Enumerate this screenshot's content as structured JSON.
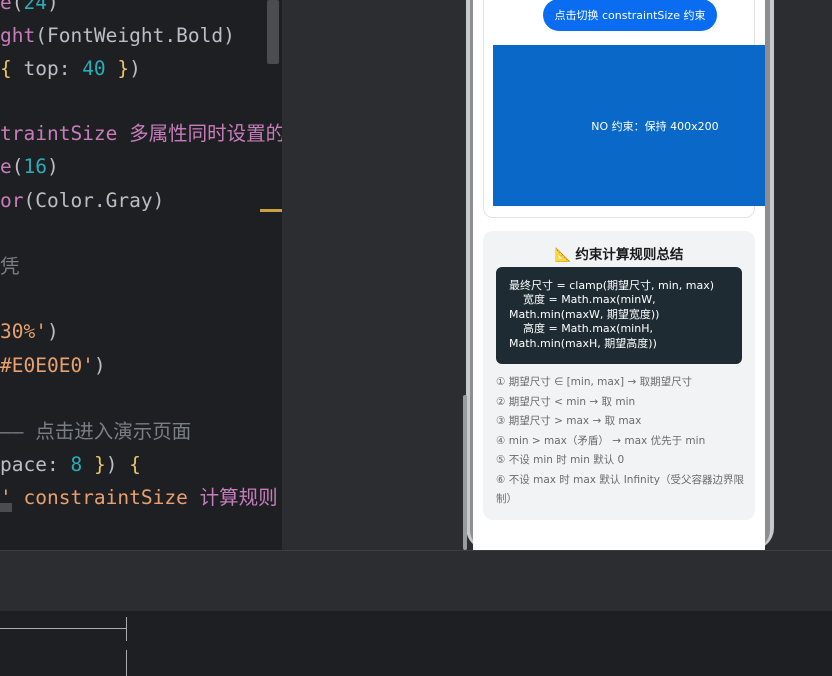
{
  "editor": {
    "lines": [
      {
        "parts": [
          [
            "c-purple",
            "e"
          ],
          [
            "c-text",
            "("
          ],
          [
            "c-num",
            "24"
          ],
          [
            "c-text",
            ")"
          ]
        ]
      },
      {
        "parts": [
          [
            "c-purple",
            "ght"
          ],
          [
            "c-text",
            "(FontWeight.Bold)"
          ]
        ]
      },
      {
        "parts": [
          [
            "c-yellow",
            "{ "
          ],
          [
            "c-text",
            "top: "
          ],
          [
            "c-num",
            "40"
          ],
          [
            "c-yellow",
            " }"
          ],
          [
            "c-text",
            ")"
          ]
        ]
      },
      {
        "parts": []
      },
      {
        "parts": [
          [
            "c-purple",
            "traintSize "
          ],
          [
            "c-purple",
            "多属性同时设置的‹"
          ]
        ]
      },
      {
        "parts": [
          [
            "c-purple",
            "e"
          ],
          [
            "c-text",
            "("
          ],
          [
            "c-num",
            "16"
          ],
          [
            "c-text",
            ")"
          ]
        ]
      },
      {
        "parts": [
          [
            "c-purple",
            "or"
          ],
          [
            "c-text",
            "(Color.Gray)"
          ]
        ]
      },
      {
        "parts": []
      },
      {
        "parts": [
          [
            "c-gray",
            "凭"
          ]
        ]
      },
      {
        "parts": []
      },
      {
        "parts": [
          [
            "c-str",
            "30%'"
          ],
          [
            "c-text",
            ")"
          ]
        ]
      },
      {
        "parts": [
          [
            "c-str",
            "#E0E0E0'"
          ],
          [
            "c-text",
            ")"
          ]
        ]
      },
      {
        "parts": []
      },
      {
        "parts": [
          [
            "c-gray",
            "—— 点击进入演示页面"
          ]
        ]
      },
      {
        "parts": [
          [
            "c-text",
            "pace: "
          ],
          [
            "c-num",
            "8"
          ],
          [
            "c-yellow",
            " }"
          ],
          [
            "c-text",
            ") "
          ],
          [
            "c-yellow",
            "{"
          ]
        ]
      },
      {
        "parts": [
          [
            "c-str",
            "' constraintSize "
          ],
          [
            "c-purple",
            "计算规则"
          ],
          [
            "c-str",
            "')"
          ]
        ]
      }
    ]
  },
  "preview": {
    "toggle_button": "点击切换 constraintSize 约束",
    "demo_box_text": "NO 约束：保持 400x200",
    "rules_icon": "📐",
    "rules_title": "约束计算规则总结",
    "formula": "最终尺寸 = clamp(期望尺寸, min, max)\n    宽度 = Math.max(minW,\nMath.min(maxW, 期望宽度))\n    高度 = Math.max(minH,\nMath.min(maxH, 期望高度))",
    "rules": [
      "① 期望尺寸 ∈ [min, max] → 取期望尺寸",
      "② 期望尺寸 < min → 取 min",
      "③ 期望尺寸 > max → 取 max",
      "④ min > max（矛盾） → max 优先于 min",
      "⑤ 不设 min 时 min 默认 0",
      "⑥ 不设 max 时 max 默认 Infinity（受父容器边界限制）"
    ]
  }
}
